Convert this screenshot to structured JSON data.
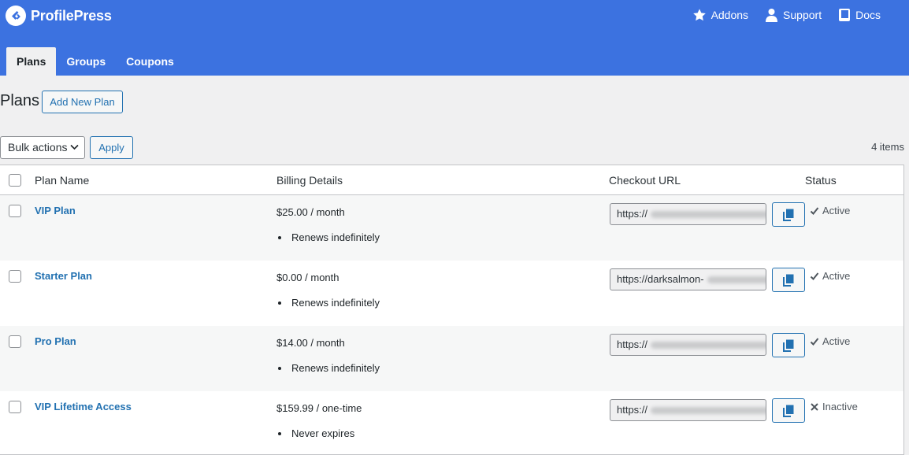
{
  "app": {
    "name": "ProfilePress"
  },
  "top_links": [
    {
      "label": "Addons",
      "icon": "star-icon"
    },
    {
      "label": "Support",
      "icon": "user-icon"
    },
    {
      "label": "Docs",
      "icon": "book-icon"
    }
  ],
  "tabs": [
    {
      "label": "Plans",
      "active": true
    },
    {
      "label": "Groups",
      "active": false
    },
    {
      "label": "Coupons",
      "active": false
    }
  ],
  "page": {
    "title": "Plans",
    "add_new_label": "Add New Plan",
    "bulk_actions_label": "Bulk actions",
    "apply_label": "Apply",
    "items_count": "4 items"
  },
  "table": {
    "columns": [
      "Plan Name",
      "Billing Details",
      "Checkout URL",
      "Status"
    ],
    "rows": [
      {
        "name": "VIP Plan",
        "price": "$25.00 / month",
        "renewal": "Renews indefinitely",
        "url": "https://",
        "status": "Active",
        "status_icon": "check-icon"
      },
      {
        "name": "Starter Plan",
        "price": "$0.00 / month",
        "renewal": "Renews indefinitely",
        "url": "https://darksalmon-",
        "status": "Active",
        "status_icon": "check-icon"
      },
      {
        "name": "Pro Plan",
        "price": "$14.00 / month",
        "renewal": "Renews indefinitely",
        "url": "https://",
        "status": "Active",
        "status_icon": "check-icon"
      },
      {
        "name": "VIP Lifetime Access",
        "price": "$159.99 / one-time",
        "renewal": "Never expires",
        "url": "https://",
        "status": "Inactive",
        "status_icon": "x-icon"
      }
    ]
  },
  "colors": {
    "brand": "#3c72e0",
    "link": "#2271b1",
    "row_alt": "#f6f7f7"
  }
}
